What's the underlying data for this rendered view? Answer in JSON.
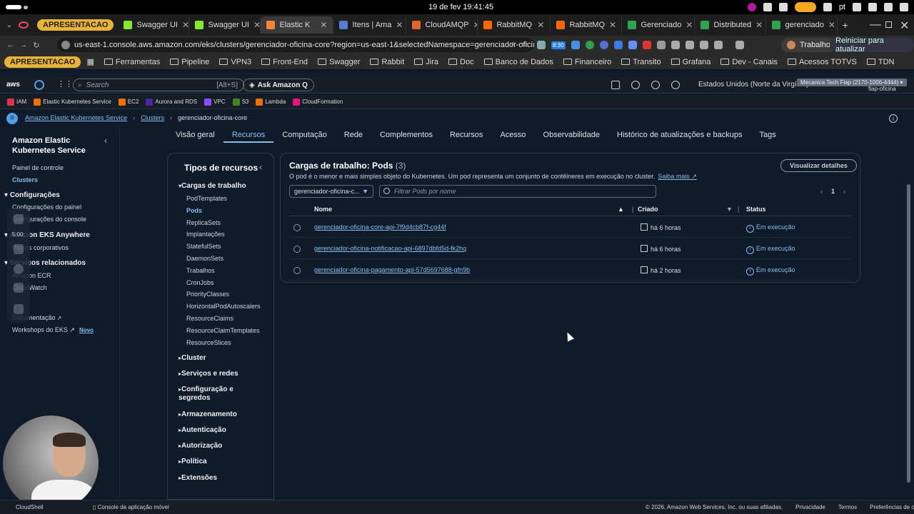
{
  "os": {
    "clock": "19 de fev  19:41:45",
    "lang": "pt"
  },
  "browser": {
    "tab_group": "APRESENTACAO",
    "tabs": [
      {
        "label": "Swagger UI",
        "color": "#85ea2d"
      },
      {
        "label": "Swagger UI",
        "color": "#85ea2d"
      },
      {
        "label": "Elastic K",
        "color": "#f58536"
      },
      {
        "label": "Itens | Ama",
        "color": "#5a7bd6"
      },
      {
        "label": "CloudAMQP",
        "color": "#e8632b"
      },
      {
        "label": "RabbitMQ",
        "color": "#ff6600"
      },
      {
        "label": "RabbitMQ",
        "color": "#ff6600"
      },
      {
        "label": "Gerenciado",
        "color": "#2ea44f"
      },
      {
        "label": "Distributed",
        "color": "#2ea44f"
      },
      {
        "label": "gerenciado",
        "color": "#2ea44f"
      }
    ],
    "url": "us-east-1.console.aws.amazon.com/eks/clusters/gerenciador-oficina-core?region=us-east-1&selectedNamespace=gerenciador-oficina-core&s...",
    "badge": "8:30",
    "profile": "Trabalho",
    "update": "Reiniciar para atualizar",
    "bookmark_group": "APRESENTACAO",
    "bookmarks": [
      "Ferramentas",
      "Pipeline",
      "VPN3",
      "Front-End",
      "Swagger",
      "Rabbit",
      "Jira",
      "Doc",
      "Banco de Dados",
      "Financeiro",
      "Transito",
      "Grafana",
      "Dev - Canais",
      "Acessos TOTVS",
      "TDN"
    ]
  },
  "aws": {
    "logo": "aws",
    "search_placeholder": "Search",
    "search_shortcut": "[Alt+S]",
    "ask_q": "Ask Amazon Q",
    "region": "Estados Unidos (Norte da Virgínia) ▾",
    "account": "Mecanica Tech Fiap (2170-1006-4444) ▾",
    "account_sub": "fiap-oficina",
    "favorites": [
      {
        "label": "IAM",
        "color": "#dd344c"
      },
      {
        "label": "Elastic Kubernetes Service",
        "color": "#ed7100"
      },
      {
        "label": "EC2",
        "color": "#ed7100"
      },
      {
        "label": "Aurora and RDS",
        "color": "#4d27aa"
      },
      {
        "label": "VPC",
        "color": "#8c4fff"
      },
      {
        "label": "S3",
        "color": "#3f8624"
      },
      {
        "label": "Lambda",
        "color": "#ed7100"
      },
      {
        "label": "CloudFormation",
        "color": "#e7157b"
      }
    ]
  },
  "breadcrumb": {
    "service": "Amazon Elastic Kubernetes Service",
    "clusters": "Clusters",
    "current": "gerenciador-oficina-core"
  },
  "sidenav": {
    "title": "Amazon Elastic Kubernetes Service",
    "panel": "Painel de controle",
    "clusters": "Clusters",
    "configs": "Configurações",
    "config_panel": "Configurações do painel",
    "config_console": "Configurações do console",
    "eks_anywhere": "Amazon EKS Anywhere",
    "corporate": "Planos corporativos",
    "related": "Serviços relacionados",
    "ecr": "Amazon ECR",
    "watch": "CloudWatch",
    "docs": "Documentação",
    "workshops": "Workshops do EKS",
    "new": "Novo"
  },
  "overlay": {
    "time": "5:00"
  },
  "tabs": [
    "Visão geral",
    "Recursos",
    "Computação",
    "Rede",
    "Complementos",
    "Recursos",
    "Acesso",
    "Observabilidade",
    "Histórico de atualizações e backups",
    "Tags"
  ],
  "resource_types": {
    "title": "Tipos de recursos",
    "workloads": "Cargas de trabalho",
    "items": [
      "PodTemplates",
      "Pods",
      "ReplicaSets",
      "Implantações",
      "StatefulSets",
      "DaemonSets",
      "Trabalhos",
      "CronJobs",
      "PriorityClasses",
      "HorizontalPodAutoscalers",
      "ResourceClaims",
      "ResourceClaimTemplates",
      "ResourceSlices"
    ],
    "groups": [
      "Cluster",
      "Serviços e redes",
      "Configuração e segredos",
      "Armazenamento",
      "Autenticação",
      "Autorização",
      "Política",
      "Extensões"
    ]
  },
  "pods": {
    "title": "Cargas de trabalho: Pods",
    "count": "(3)",
    "description": "O pod é o menor e mais simples objeto do Kubernetes. Um pod representa um conjunto de contêineres em execução no cluster.",
    "learn_more": "Saiba mais",
    "details_button": "Visualizar detalhes",
    "namespace": "gerenciador-oficina-c...",
    "filter_placeholder": "Filtrar Pods por nome",
    "page": "1",
    "columns": {
      "name": "Nome",
      "created": "Criado",
      "status": "Status"
    },
    "rows": [
      {
        "name": "gerenciador-oficina-core-api-7f9d4cb87f-cg44f",
        "created": "há 6 horas",
        "status": "Em execução"
      },
      {
        "name": "gerenciador-oficina-notificacao-api-6897dbfd5d-fk2hq",
        "created": "há 6 horas",
        "status": "Em execução"
      },
      {
        "name": "gerenciador-oficina-pagamento-api-57d5697688-gfn9b",
        "created": "há 2 horas",
        "status": "Em execução"
      }
    ]
  },
  "footer": {
    "cloudshell": "CloudShell",
    "mobile": "Console da aplicação móvel",
    "copyright": "© 2026, Amazon Web Services, Inc. ou suas afiliadas.",
    "privacy": "Privacidade",
    "terms": "Termos",
    "cookies": "Preferências de cookies"
  }
}
